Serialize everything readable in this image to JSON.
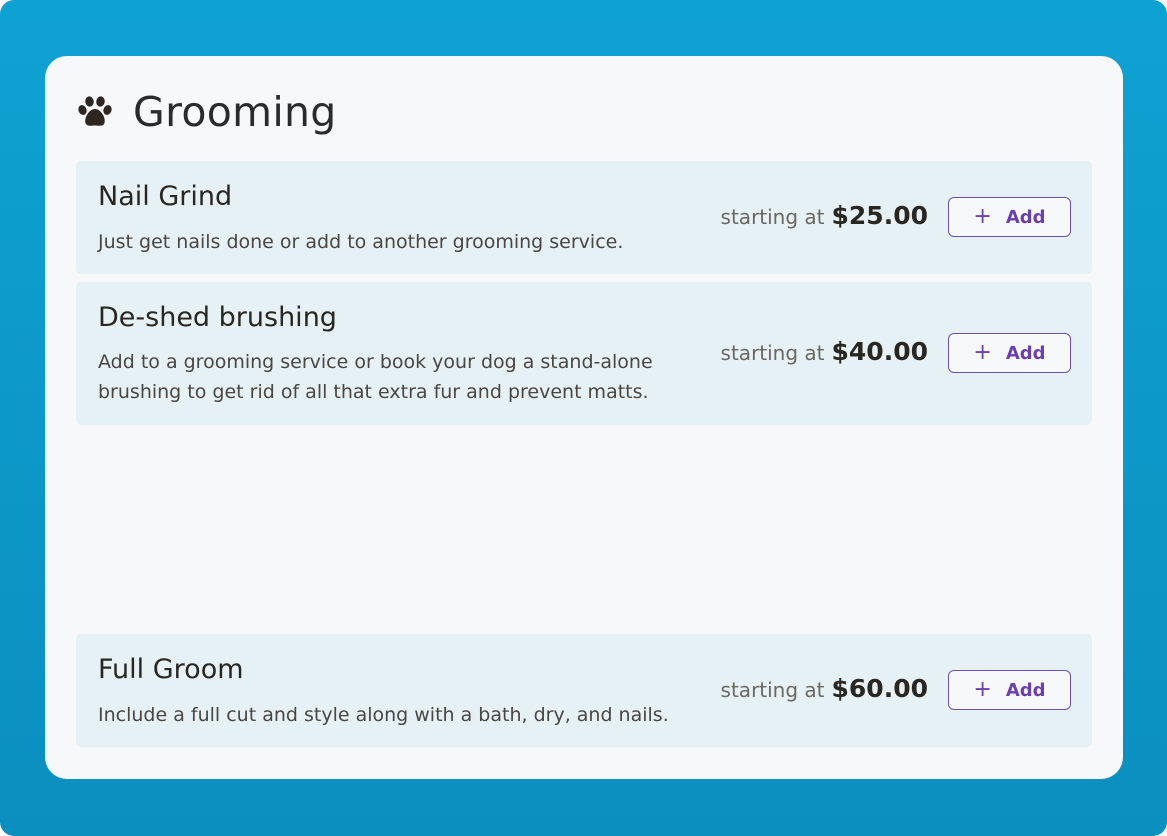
{
  "section": {
    "title": "Grooming",
    "icon": "paw-icon"
  },
  "services": [
    {
      "name": "Nail Grind",
      "description": "Just get nails done or add to another grooming service.",
      "price_prefix": "starting at",
      "price": "$25.00",
      "button_label": "Add",
      "button_icon": "plus-icon"
    },
    {
      "name": "De-shed brushing",
      "description": "Add to a grooming service or book your dog a stand-alone brushing to get rid of all that extra fur and prevent matts.",
      "price_prefix": "starting at",
      "price": "$40.00",
      "button_label": "Add",
      "button_icon": "plus-icon"
    },
    {
      "name": "Full Groom",
      "description": "Include a full cut and style along with a bath, dry, and nails.",
      "price_prefix": "starting at",
      "price": "$60.00",
      "button_label": "Add",
      "button_icon": "plus-icon"
    }
  ],
  "colors": {
    "background": "#0ea2d2",
    "card": "#f7f8fa",
    "row": "#e6f1f5",
    "accent": "#6a3fb0"
  }
}
